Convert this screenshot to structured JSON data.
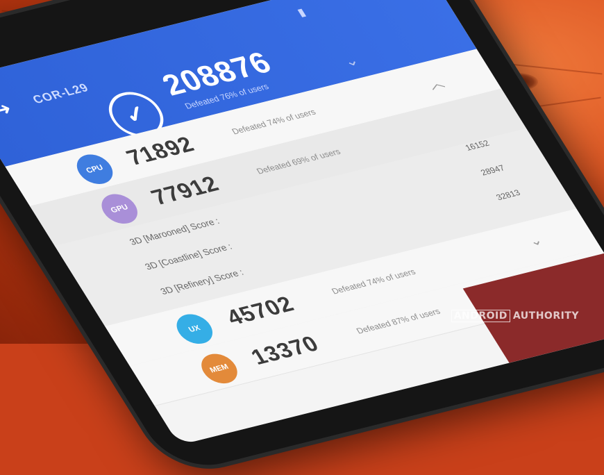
{
  "device": {
    "model": "COR-L29",
    "total_score": "208876",
    "total_defeated": "Defeated 76% of users"
  },
  "rows": {
    "cpu": {
      "badge": "CPU",
      "score": "71892",
      "defeated": "Defeated 74% of users",
      "color": "#3f7de0"
    },
    "gpu": {
      "badge": "GPU",
      "score": "77912",
      "defeated": "Defeated 69% of users",
      "color": "#a98fd8"
    },
    "ux": {
      "badge": "UX",
      "score": "45702",
      "defeated": "Defeated 74% of users",
      "color": "#35aee6"
    },
    "mem": {
      "badge": "MEM",
      "score": "13370",
      "defeated": "Defeated 87% of users",
      "color": "#e38a3a"
    }
  },
  "gpu_details": [
    {
      "label": "3D [Marooned] Score :",
      "value": "16152"
    },
    {
      "label": "3D [Coastline] Score :",
      "value": "28947"
    },
    {
      "label": "3D [Refinery] Score :",
      "value": "32813"
    }
  ],
  "watermark": {
    "part1": "ANDROID",
    "part2": "AUTHORITY"
  },
  "colors": {
    "header_blue": "#3a6fe6",
    "wood": "#c9401a"
  }
}
